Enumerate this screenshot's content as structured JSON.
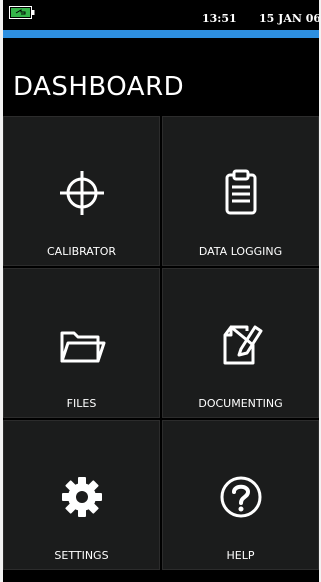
{
  "status": {
    "time": "13:51",
    "date": "15 JAN 06",
    "battery_icon": "battery-charging-icon"
  },
  "page": {
    "title": "DASHBOARD"
  },
  "tiles": [
    {
      "label": "CALIBRATOR",
      "icon": "crosshair-icon"
    },
    {
      "label": "DATA LOGGING",
      "icon": "clipboard-icon"
    },
    {
      "label": "FILES",
      "icon": "folder-icon"
    },
    {
      "label": "DOCUMENTING",
      "icon": "document-pen-icon"
    },
    {
      "label": "SETTINGS",
      "icon": "gear-icon"
    },
    {
      "label": "HELP",
      "icon": "help-icon"
    }
  ],
  "colors": {
    "accent": "#2e8fe0",
    "tile_bg": "#1b1c1c",
    "battery_fill": "#35b44a"
  }
}
